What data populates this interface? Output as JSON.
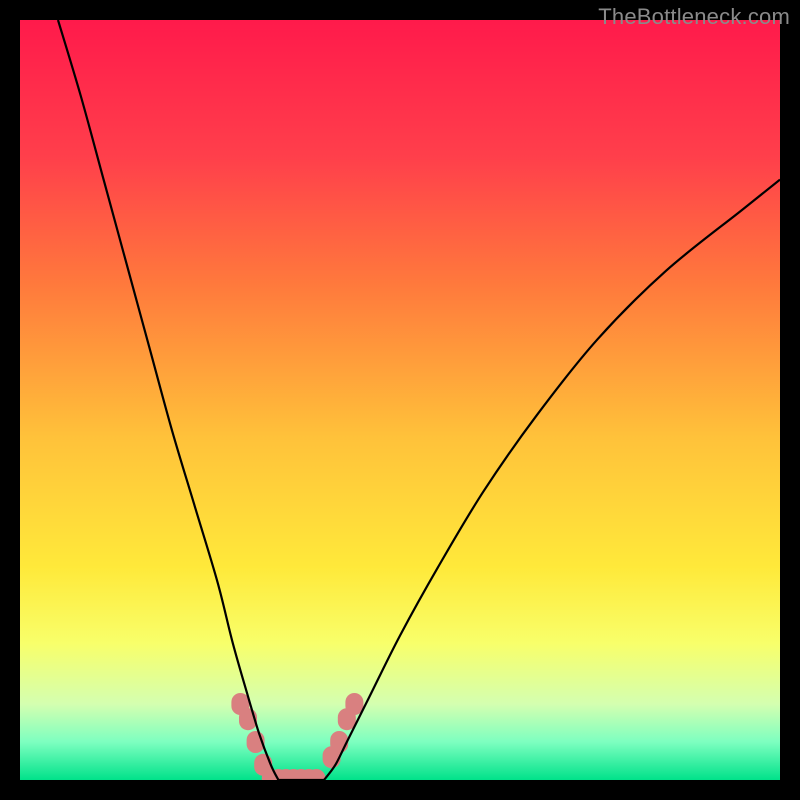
{
  "watermark": "TheBottleneck.com",
  "chart_data": {
    "type": "line",
    "title": "",
    "xlabel": "",
    "ylabel": "",
    "xlim": [
      0,
      100
    ],
    "ylim": [
      0,
      100
    ],
    "grid": false,
    "background_gradient": {
      "stops": [
        {
          "pos": 0.0,
          "color": "#ff1a4b"
        },
        {
          "pos": 0.18,
          "color": "#ff3f4b"
        },
        {
          "pos": 0.35,
          "color": "#ff7a3c"
        },
        {
          "pos": 0.55,
          "color": "#ffc23a"
        },
        {
          "pos": 0.72,
          "color": "#ffe93a"
        },
        {
          "pos": 0.82,
          "color": "#f8ff6a"
        },
        {
          "pos": 0.9,
          "color": "#d4ffb0"
        },
        {
          "pos": 0.95,
          "color": "#7dffc0"
        },
        {
          "pos": 1.0,
          "color": "#00e28a"
        }
      ]
    },
    "series": [
      {
        "name": "left-curve",
        "x": [
          5,
          8,
          11,
          14,
          17,
          20,
          23,
          26,
          28,
          30,
          31.5,
          33,
          34
        ],
        "y": [
          100,
          90,
          79,
          68,
          57,
          46,
          36,
          26,
          18,
          11,
          6,
          2,
          0
        ]
      },
      {
        "name": "right-curve",
        "x": [
          40,
          41.5,
          43,
          46,
          50,
          55,
          61,
          68,
          76,
          85,
          95,
          100
        ],
        "y": [
          0,
          2,
          5,
          11,
          19,
          28,
          38,
          48,
          58,
          67,
          75,
          79
        ]
      },
      {
        "name": "valley-floor",
        "x": [
          34,
          35,
          36,
          37,
          38,
          39,
          40
        ],
        "y": [
          0,
          0,
          0,
          0,
          0,
          0,
          0
        ]
      }
    ],
    "markers": [
      {
        "name": "left-cluster",
        "shape": "rounded",
        "color": "#d98080",
        "points": [
          [
            29,
            10
          ],
          [
            30,
            8
          ],
          [
            31,
            5
          ],
          [
            32,
            2
          ],
          [
            33,
            0
          ],
          [
            34,
            0
          ],
          [
            35,
            0
          ],
          [
            36,
            0
          ],
          [
            37,
            0
          ],
          [
            38,
            0
          ],
          [
            39,
            0
          ]
        ]
      },
      {
        "name": "right-cluster",
        "shape": "rounded",
        "color": "#d98080",
        "points": [
          [
            41,
            3
          ],
          [
            42,
            5
          ],
          [
            43,
            8
          ],
          [
            44,
            10
          ]
        ]
      }
    ],
    "valley_x": 37,
    "valley_y": 0
  }
}
